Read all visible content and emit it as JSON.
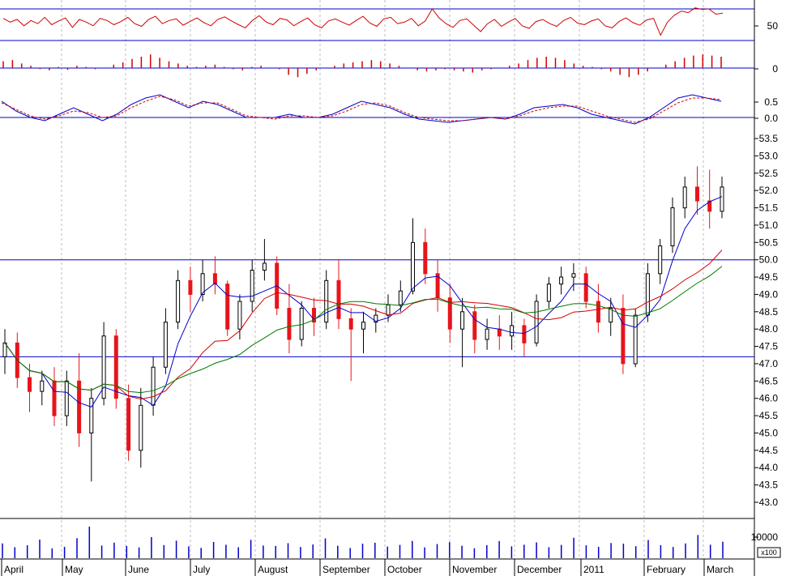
{
  "colors": {
    "up_candle": "#000000",
    "down_candle": "#e8141b",
    "ma_blue": "#0000cc",
    "ma_red": "#d10000",
    "ma_green": "#007a00",
    "hline": "#0000cc",
    "osc_red": "#d10000",
    "grid": "#bdbdbd"
  },
  "chart_data": [
    {
      "type": "line",
      "panel": "oscillator",
      "y_ticks": [
        "50"
      ],
      "reference_levels": [
        80,
        20
      ],
      "values_estimated": [
        62,
        55,
        60,
        48,
        58,
        52,
        64,
        50,
        57,
        63,
        45,
        60,
        55,
        48,
        62,
        58,
        50,
        56,
        64,
        52,
        47,
        60,
        66,
        52,
        58,
        61,
        49,
        56,
        63,
        54,
        48,
        60,
        65,
        57,
        50,
        44,
        58,
        67,
        55,
        50,
        62,
        59,
        48,
        56,
        63,
        50,
        44,
        57,
        61,
        55,
        49,
        58,
        66,
        53,
        47,
        61,
        64,
        52,
        55,
        62,
        48,
        57,
        80,
        63,
        52,
        45,
        58,
        61,
        49,
        37,
        52,
        60,
        47,
        55,
        62,
        48,
        43,
        56,
        60,
        52,
        47,
        58,
        64,
        53,
        50,
        57,
        61,
        48,
        44,
        56,
        63,
        54,
        49,
        59,
        62,
        30,
        55,
        68,
        76,
        73,
        82,
        79,
        80,
        70,
        72
      ]
    },
    {
      "type": "bar",
      "panel": "momentum histogram",
      "y_ticks": [
        "0"
      ],
      "values_estimated": [
        0.3,
        0.35,
        0.2,
        0.1,
        -0.05,
        -0.1,
        0.05,
        -0.08,
        0.1,
        0.05,
        -0.05,
        0.0,
        0.15,
        0.25,
        0.4,
        0.5,
        0.6,
        0.45,
        0.3,
        0.2,
        0.1,
        0.05,
        0.1,
        0.15,
        0.05,
        -0.05,
        -0.1,
        0.05,
        0.1,
        0.0,
        -0.05,
        -0.3,
        -0.4,
        -0.25,
        -0.1,
        0.0,
        0.1,
        0.2,
        0.25,
        0.3,
        0.35,
        0.3,
        0.2,
        0.1,
        0.0,
        -0.1,
        -0.15,
        -0.1,
        -0.05,
        -0.1,
        -0.15,
        -0.2,
        -0.1,
        -0.05,
        0.0,
        0.1,
        0.2,
        0.35,
        0.45,
        0.5,
        0.45,
        0.35,
        0.2,
        0.1,
        0.05,
        -0.05,
        -0.15,
        -0.3,
        -0.4,
        -0.3,
        -0.15,
        0.0,
        0.15,
        0.3,
        0.45,
        0.55,
        0.6,
        0.55,
        0.5
      ]
    },
    {
      "type": "line",
      "panel": "oscillator (two lines)",
      "y_ticks": [
        "0.5",
        "0.0"
      ],
      "series": [
        {
          "name": "",
          "color_key": "ma_blue",
          "values": [
            0.5,
            0.2,
            0.0,
            -0.1,
            0.1,
            0.3,
            0.1,
            -0.1,
            0.1,
            0.4,
            0.6,
            0.7,
            0.5,
            0.3,
            0.5,
            0.4,
            0.2,
            0.0,
            0.0,
            0.0,
            0.1,
            0.0,
            0.0,
            0.1,
            0.3,
            0.5,
            0.4,
            0.3,
            0.1,
            -0.05,
            -0.1,
            -0.15,
            -0.1,
            -0.05,
            0.0,
            -0.05,
            0.1,
            0.3,
            0.35,
            0.4,
            0.3,
            0.1,
            0.0,
            -0.1,
            -0.2,
            0.0,
            0.3,
            0.6,
            0.7,
            0.6,
            0.5
          ]
        },
        {
          "name": "",
          "color_key": "ma_red",
          "values": [
            0.45,
            0.25,
            0.05,
            -0.05,
            0.05,
            0.2,
            0.15,
            0.0,
            0.05,
            0.3,
            0.5,
            0.65,
            0.55,
            0.35,
            0.45,
            0.45,
            0.25,
            0.05,
            0.0,
            -0.05,
            0.05,
            0.05,
            0.0,
            0.05,
            0.2,
            0.4,
            0.45,
            0.35,
            0.15,
            0.0,
            -0.05,
            -0.1,
            -0.1,
            -0.05,
            0.0,
            -0.05,
            0.05,
            0.2,
            0.3,
            0.35,
            0.35,
            0.2,
            0.05,
            -0.05,
            -0.15,
            -0.05,
            0.2,
            0.45,
            0.6,
            0.6,
            0.55
          ]
        }
      ]
    },
    {
      "type": "line",
      "panel": "price (candlestick)",
      "x_labels": [
        "April",
        "May",
        "June",
        "July",
        "August",
        "September",
        "October",
        "November",
        "December",
        "2011",
        "February",
        "March"
      ],
      "y_ticks": [
        "53.5",
        "53.0",
        "52.5",
        "52.0",
        "51.5",
        "51.0",
        "50.5",
        "50.0",
        "49.5",
        "49.0",
        "48.5",
        "48.0",
        "47.5",
        "47.0",
        "46.5",
        "46.0",
        "45.5",
        "45.0",
        "44.5",
        "44.0",
        "43.5",
        "43.0"
      ],
      "ylim": [
        42.5,
        53.9
      ],
      "horizontal_lines": [
        50.0,
        47.2
      ],
      "candles_estimated": [
        [
          47.2,
          48.0,
          46.7,
          47.6
        ],
        [
          47.6,
          47.9,
          46.3,
          46.6
        ],
        [
          46.6,
          47.0,
          45.6,
          46.2
        ],
        [
          46.2,
          46.8,
          45.8,
          46.5
        ],
        [
          46.5,
          46.9,
          45.2,
          45.5
        ],
        [
          45.5,
          46.8,
          45.2,
          46.5
        ],
        [
          46.5,
          47.3,
          44.6,
          45.0
        ],
        [
          45.0,
          46.3,
          43.6,
          46.0
        ],
        [
          46.0,
          48.2,
          45.8,
          47.8
        ],
        [
          47.8,
          48.0,
          45.7,
          46.0
        ],
        [
          46.0,
          46.4,
          44.2,
          44.5
        ],
        [
          44.5,
          46.3,
          44.0,
          45.8
        ],
        [
          45.8,
          47.2,
          45.5,
          46.9
        ],
        [
          46.9,
          48.6,
          46.7,
          48.2
        ],
        [
          48.2,
          49.7,
          48.0,
          49.4
        ],
        [
          49.4,
          49.8,
          48.5,
          49.0
        ],
        [
          49.0,
          50.0,
          48.8,
          49.6
        ],
        [
          49.6,
          50.1,
          49.0,
          49.3
        ],
        [
          49.3,
          49.4,
          47.8,
          48.0
        ],
        [
          48.0,
          49.0,
          47.7,
          48.8
        ],
        [
          48.8,
          50.0,
          48.5,
          49.7
        ],
        [
          49.7,
          50.6,
          49.4,
          49.9
        ],
        [
          49.9,
          50.1,
          48.4,
          48.6
        ],
        [
          48.6,
          49.3,
          47.3,
          47.7
        ],
        [
          47.7,
          48.8,
          47.5,
          48.6
        ],
        [
          48.6,
          48.9,
          47.8,
          48.2
        ],
        [
          48.2,
          49.7,
          48.0,
          49.4
        ],
        [
          49.4,
          50.0,
          48.0,
          48.3
        ],
        [
          48.3,
          48.6,
          46.5,
          48.0
        ],
        [
          48.0,
          48.5,
          47.3,
          48.2
        ],
        [
          48.2,
          48.6,
          47.9,
          48.4
        ],
        [
          48.4,
          49.0,
          48.2,
          48.7
        ],
        [
          48.7,
          49.4,
          48.5,
          49.1
        ],
        [
          49.1,
          51.2,
          49.0,
          50.5
        ],
        [
          50.5,
          50.9,
          49.3,
          49.6
        ],
        [
          49.6,
          50.0,
          48.5,
          48.9
        ],
        [
          48.9,
          49.3,
          47.6,
          48.0
        ],
        [
          48.0,
          48.9,
          46.9,
          48.5
        ],
        [
          48.5,
          48.7,
          47.3,
          47.7
        ],
        [
          47.7,
          48.3,
          47.4,
          48.0
        ],
        [
          48.0,
          48.4,
          47.4,
          47.8
        ],
        [
          47.8,
          48.5,
          47.4,
          48.1
        ],
        [
          48.1,
          48.3,
          47.2,
          47.6
        ],
        [
          47.6,
          49.0,
          47.5,
          48.8
        ],
        [
          48.8,
          49.5,
          48.6,
          49.3
        ],
        [
          49.3,
          49.8,
          49.0,
          49.5
        ],
        [
          49.5,
          49.9,
          49.1,
          49.6
        ],
        [
          49.6,
          49.8,
          48.6,
          48.8
        ],
        [
          48.8,
          49.3,
          47.9,
          48.2
        ],
        [
          48.2,
          48.9,
          47.8,
          48.6
        ],
        [
          48.6,
          49.0,
          46.7,
          47.0
        ],
        [
          47.0,
          48.6,
          46.9,
          48.4
        ],
        [
          48.4,
          49.9,
          48.2,
          49.6
        ],
        [
          49.6,
          50.6,
          49.3,
          50.4
        ],
        [
          50.4,
          51.8,
          50.2,
          51.5
        ],
        [
          51.5,
          52.4,
          51.2,
          52.1
        ],
        [
          52.1,
          52.7,
          51.3,
          51.7
        ],
        [
          51.7,
          52.6,
          50.9,
          51.4
        ],
        [
          51.4,
          52.4,
          51.2,
          52.1
        ]
      ]
    },
    {
      "type": "bar",
      "panel": "volume",
      "y_ticks": [
        "10000"
      ],
      "y_unit_label": "x100",
      "values_estimated": [
        7000,
        5200,
        6100,
        8800,
        4600,
        5400,
        9500,
        15000,
        6000,
        7400,
        5800,
        5100,
        10000,
        6200,
        8300,
        5600,
        4900,
        7700,
        6400,
        5200,
        8700,
        6000,
        5800,
        7100,
        5300,
        6500,
        9400,
        5900,
        4800,
        6900,
        7300,
        5500,
        6300,
        8200,
        5100,
        6700,
        7600,
        5900,
        4700,
        6200,
        8100,
        5600,
        6400,
        7500,
        5200,
        6300,
        9700,
        6100,
        5400,
        7200,
        6900,
        5700,
        8600,
        6200,
        5300,
        7000,
        11000,
        6400,
        7800
      ]
    }
  ]
}
